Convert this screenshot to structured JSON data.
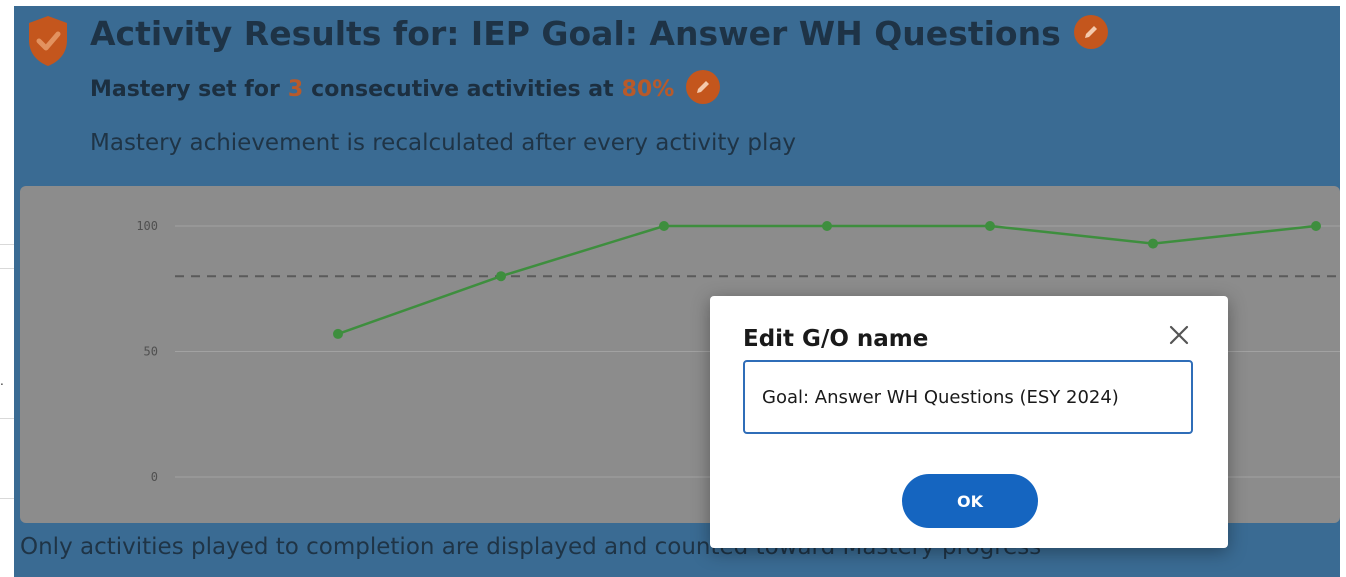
{
  "header": {
    "title": "Activity Results for:  IEP Goal: Answer WH Questions",
    "mastery_prefix": "Mastery set for",
    "mastery_count": "3",
    "mastery_middle": "consecutive activities at",
    "mastery_percent": "80%",
    "recalc_note": "Mastery achievement is recalculated after every activity play"
  },
  "chart_data": {
    "type": "line",
    "y_ticks": [
      "100",
      "50",
      "0"
    ],
    "ylim": [
      0,
      100
    ],
    "threshold": 80,
    "grid": true,
    "x": [
      1,
      2,
      3,
      4,
      5,
      6,
      7
    ],
    "values": [
      57,
      80,
      100,
      100,
      100,
      93,
      100
    ]
  },
  "footer": {
    "note": "Only activities played to completion are displayed and counted toward Mastery progress"
  },
  "modal": {
    "title": "Edit G/O name",
    "input_value": "Goal: Answer WH Questions (ESY 2024)",
    "ok_label": "OK"
  },
  "icons": {
    "shield": "shield-check-icon",
    "edit": "pencil-icon",
    "close": "close-icon"
  },
  "colors": {
    "panel": "#3a6b93",
    "accent": "#c4561d",
    "series": "#3e8e3e",
    "primary_button": "#1565c0"
  }
}
